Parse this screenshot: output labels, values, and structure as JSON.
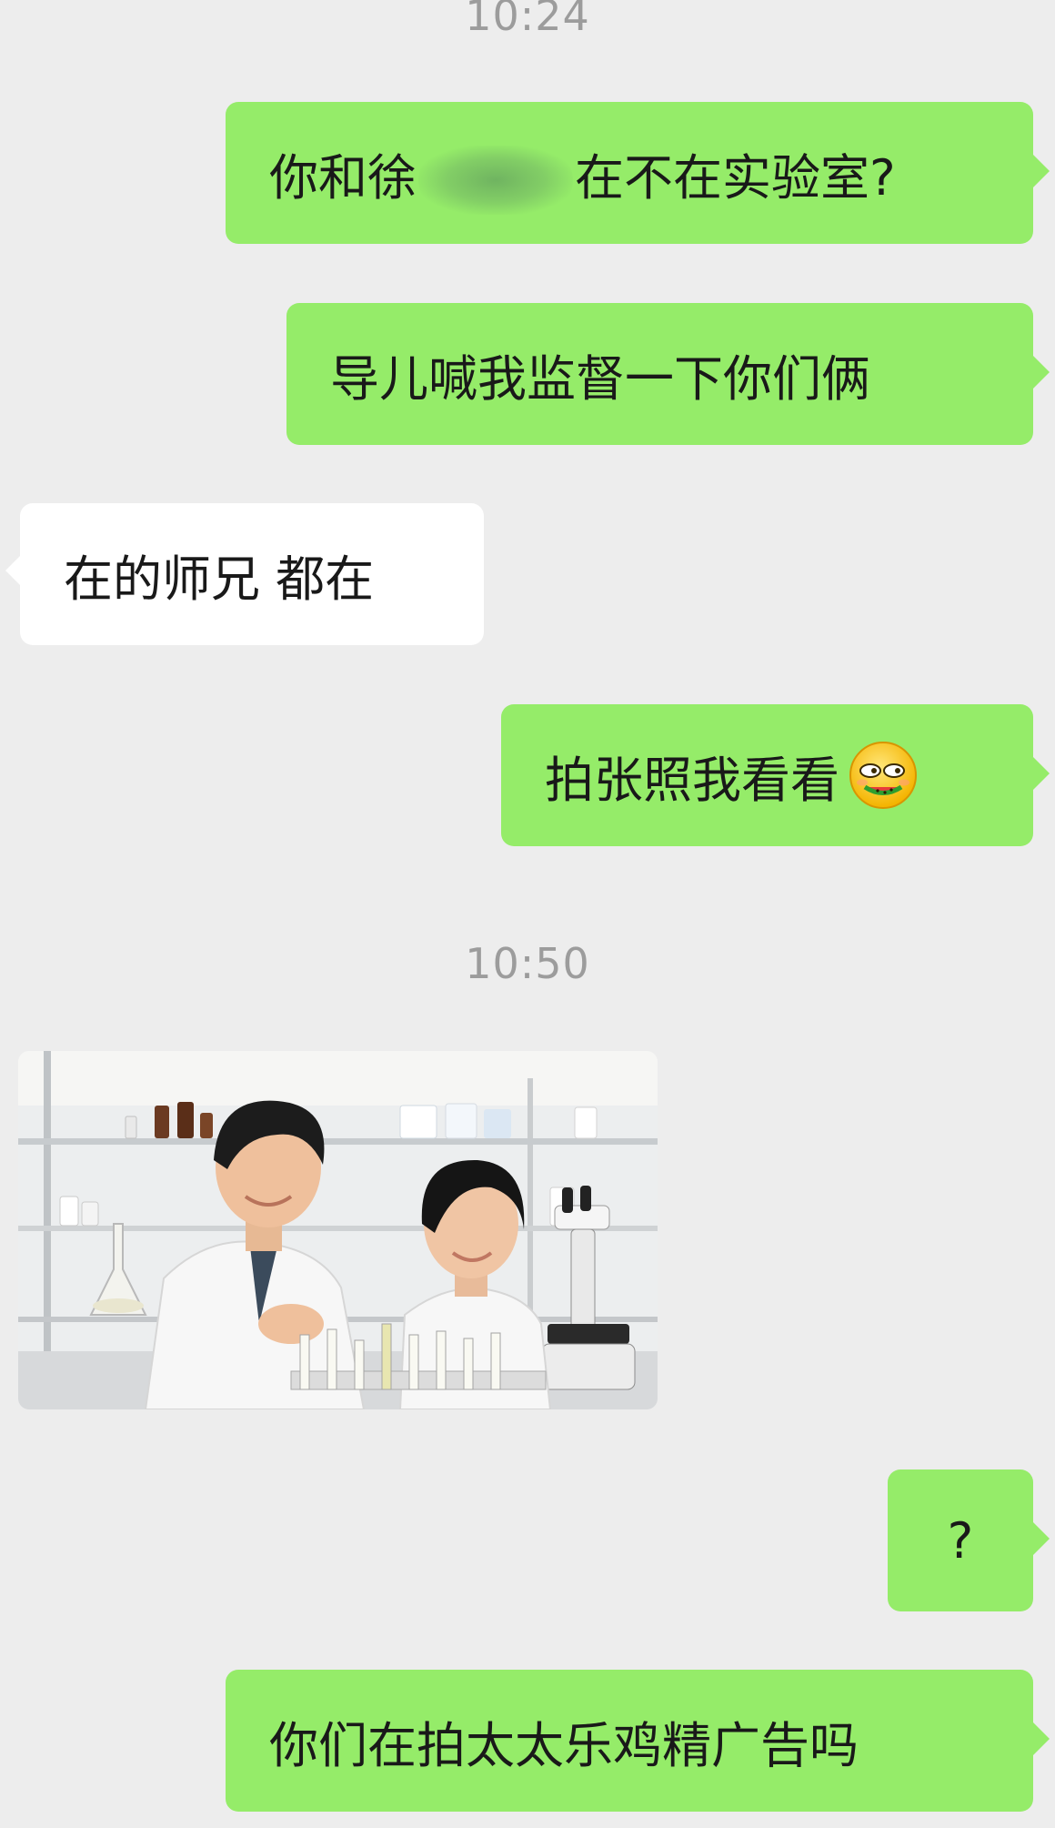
{
  "timestamps": [
    "10:24",
    "10:50"
  ],
  "messages": [
    {
      "sender": "me",
      "parts": [
        "你和徐",
        "在不在实验室?"
      ],
      "redacted": true
    },
    {
      "sender": "me",
      "text": "导儿喊我监督一下你们俩"
    },
    {
      "sender": "other",
      "text": "在的师兄 都在"
    },
    {
      "sender": "me",
      "text": "拍张照我看看",
      "emoji": "eating-watermelon-emoji-icon"
    },
    {
      "sender": "other",
      "type": "image",
      "image": "lab-photo-two-researchers"
    },
    {
      "sender": "me",
      "text": "?"
    },
    {
      "sender": "me",
      "text": "你们在拍太太乐鸡精广告吗"
    }
  ],
  "colors": {
    "background": "#ededed",
    "my_bubble": "#95ec69",
    "other_bubble": "#ffffff",
    "timestamp": "#9c9c9c"
  }
}
